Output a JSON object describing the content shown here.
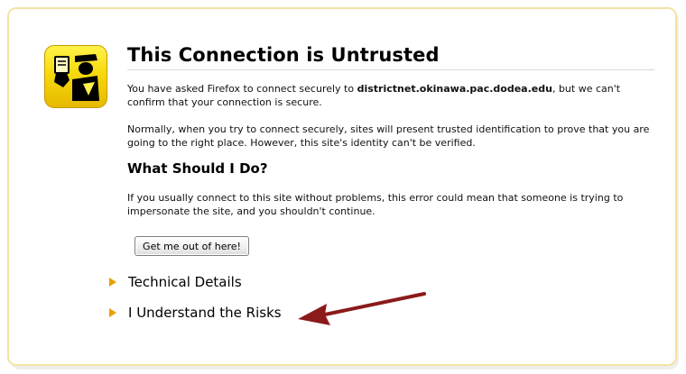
{
  "header": {
    "title": "This Connection is Untrusted"
  },
  "message": {
    "p1_prefix": "You have asked Firefox to connect securely to ",
    "p1_host": "districtnet.okinawa.pac.dodea.edu",
    "p1_suffix": ", but we can't confirm that your connection is secure.",
    "p2": "Normally, when you try to connect securely, sites will present trusted identification to prove that you are going to the right place. However, this site's identity can't be verified."
  },
  "what_to_do": {
    "heading": "What Should I Do?",
    "text": "If you usually connect to this site without problems, this error could mean that someone is trying to impersonate the site, and you shouldn't continue.",
    "escape_button": "Get me out of here!"
  },
  "expanders": {
    "technical_details": "Technical Details",
    "understand_risks": "I Understand the Risks"
  },
  "icons": {
    "badge": "security-officer-icon",
    "expander": "triangle-right-icon",
    "annotation": "red-arrow-icon"
  },
  "colors": {
    "badge_yellow": "#f6d90d",
    "expander_orange": "#e8a000",
    "arrow_red": "#8b1a1a",
    "frame_border": "#f3e3a3"
  }
}
